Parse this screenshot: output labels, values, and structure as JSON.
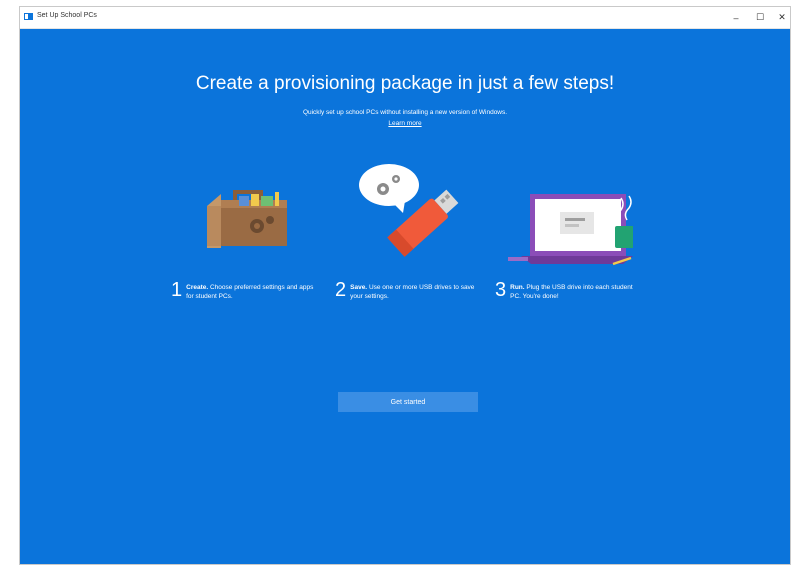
{
  "window": {
    "title": "Set Up School PCs",
    "controls": {
      "minimize": "–",
      "maximize": "☐",
      "close": "✕"
    }
  },
  "main": {
    "headline": "Create a provisioning package in just a few steps!",
    "subtitle": "Quickly set up school PCs without installing a new version of Windows.",
    "learn_more": "Learn more",
    "steps": [
      {
        "number": "1",
        "title": "Create.",
        "text": "Choose preferred settings and apps for student PCs."
      },
      {
        "number": "2",
        "title": "Save.",
        "text": "Use one or more USB drives to save your settings."
      },
      {
        "number": "3",
        "title": "Run.",
        "text": "Plug the USB drive into each student PC. You're done!"
      }
    ],
    "get_started": "Get started"
  },
  "colors": {
    "background": "#0b74db",
    "button": "#3a8ee4",
    "text": "#ffffff"
  },
  "icons": [
    "toolbox-illustration",
    "usb-drive-illustration",
    "laptop-illustration"
  ]
}
